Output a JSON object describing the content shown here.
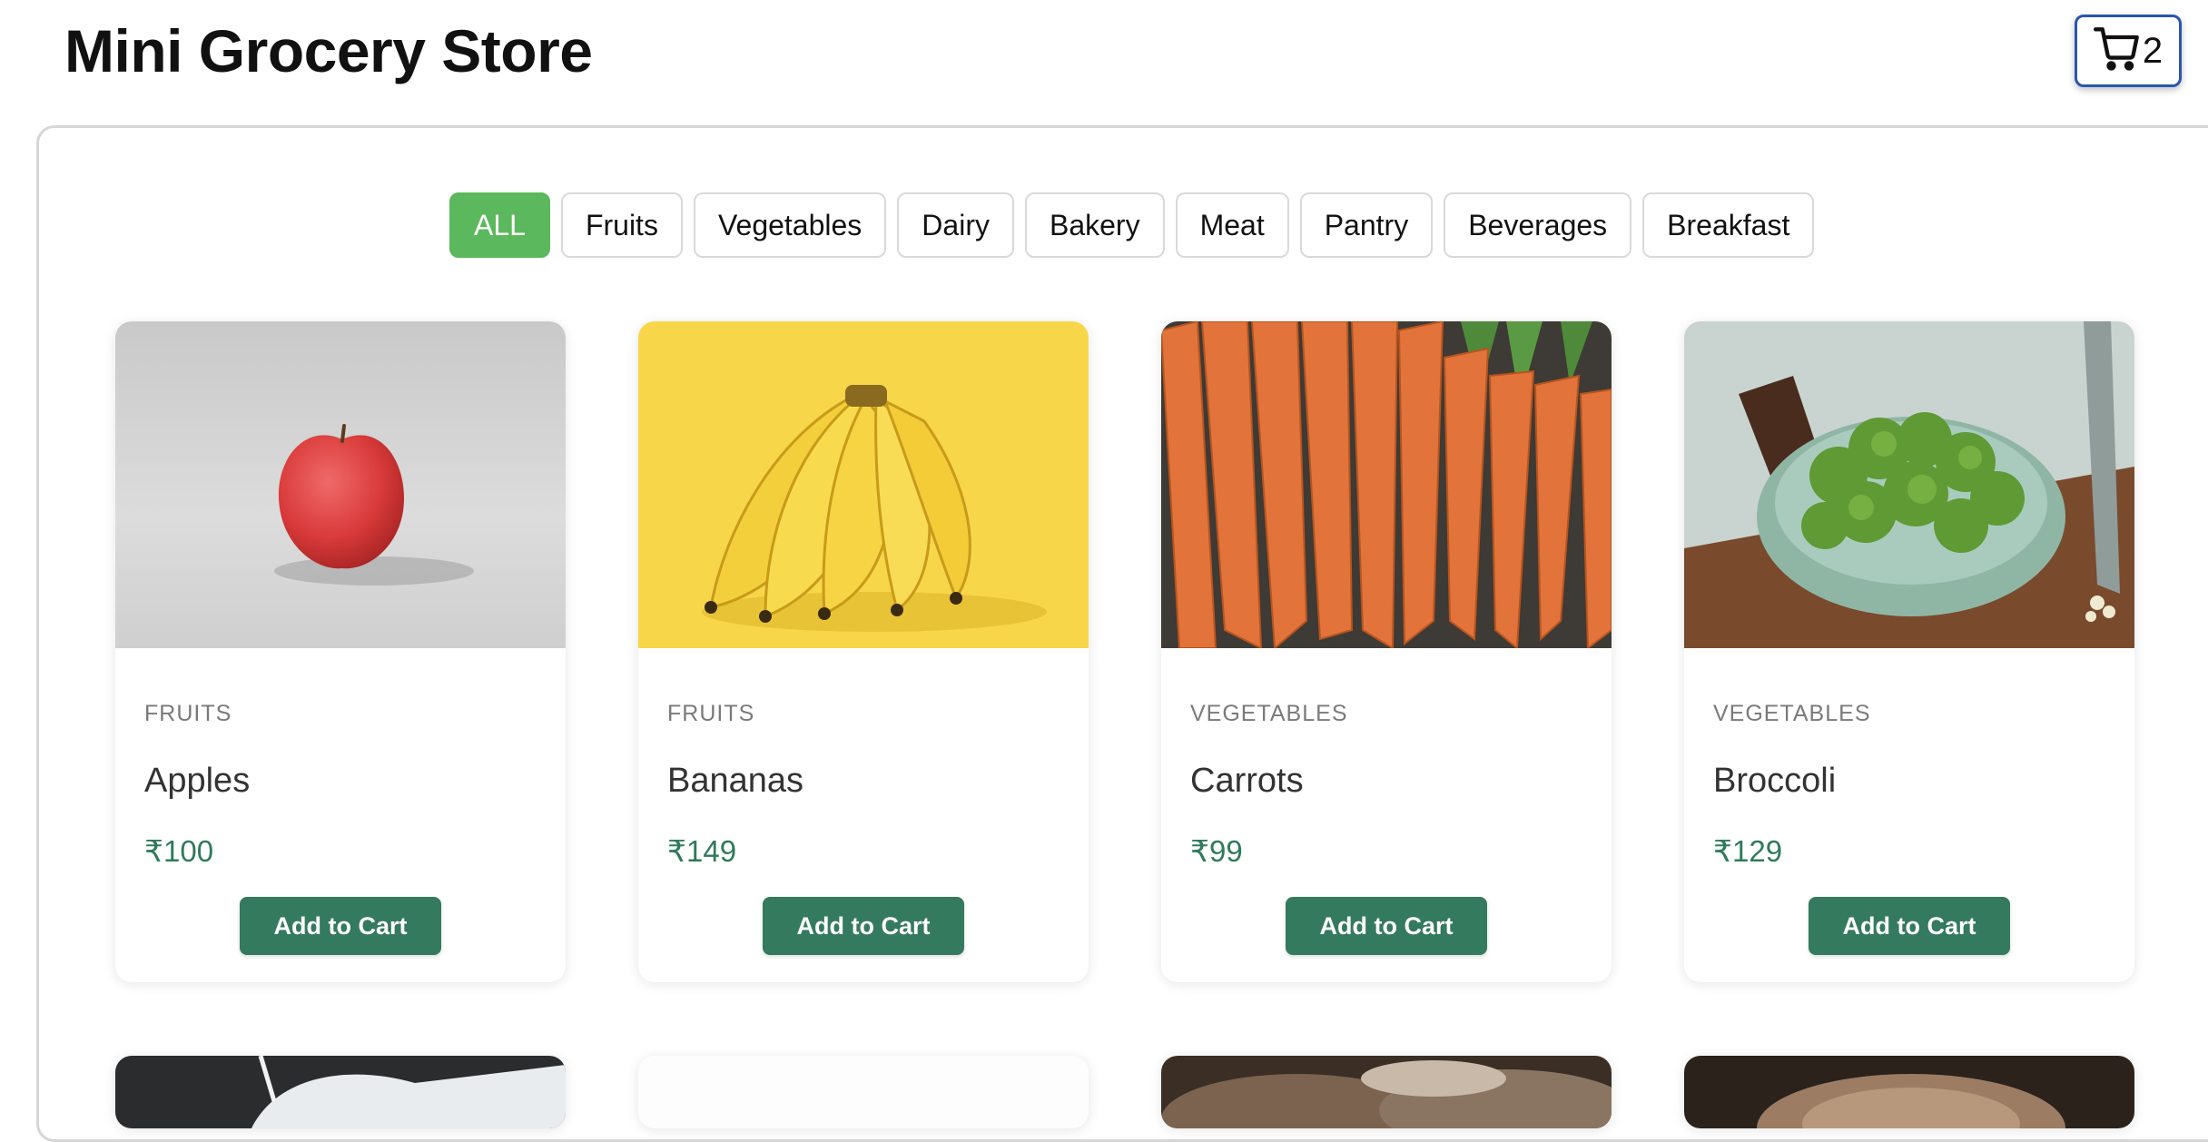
{
  "header": {
    "title": "Mini Grocery Store",
    "cart_count": "2"
  },
  "filters": [
    "ALL",
    "Fruits",
    "Vegetables",
    "Dairy",
    "Bakery",
    "Meat",
    "Pantry",
    "Beverages",
    "Breakfast"
  ],
  "active_filter": "ALL",
  "products": [
    {
      "category": "FRUITS",
      "name": "Apples",
      "price": "₹100",
      "button": "Add to Cart",
      "image": "apple-photo"
    },
    {
      "category": "FRUITS",
      "name": "Bananas",
      "price": "₹149",
      "button": "Add to Cart",
      "image": "banana-photo"
    },
    {
      "category": "VEGETABLES",
      "name": "Carrots",
      "price": "₹99",
      "button": "Add to Cart",
      "image": "carrot-photo"
    },
    {
      "category": "VEGETABLES",
      "name": "Broccoli",
      "price": "₹129",
      "button": "Add to Cart",
      "image": "broccoli-photo"
    }
  ],
  "colors": {
    "accent_green": "#5cb85c",
    "button_green": "#347a5e",
    "price_green": "#2f7a5c",
    "cart_border": "#2a55b0"
  }
}
